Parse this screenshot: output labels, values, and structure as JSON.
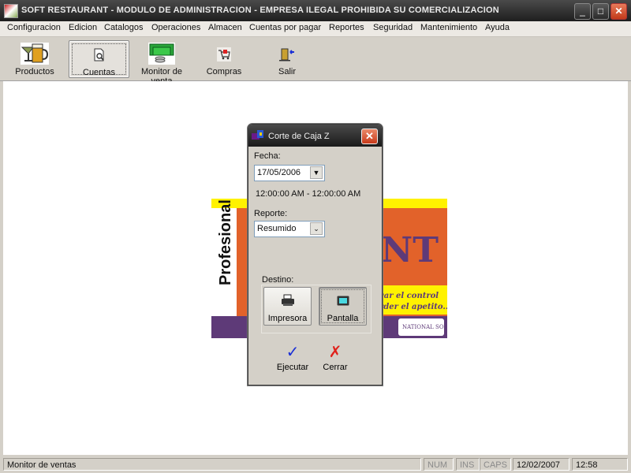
{
  "window": {
    "title": "SOFT RESTAURANT  -  MODULO DE ADMINISTRACION - EMPRESA ILEGAL PROHIBIDA SU COMERCIALIZACION",
    "controls": {
      "minimize": "_",
      "maximize": "□",
      "close": "✕"
    }
  },
  "menu": {
    "items": [
      "Configuracion",
      "Edicion",
      "Catalogos",
      "Operaciones",
      "Almacen",
      "Cuentas por pagar",
      "Reportes",
      "Seguridad",
      "Mantenimiento",
      "Ayuda"
    ]
  },
  "toolbar": {
    "items": [
      {
        "label": "Productos",
        "icon": "drinks-icon"
      },
      {
        "label": "Cuentas",
        "icon": "document-search-icon",
        "active": true
      },
      {
        "label": "Monitor de venta",
        "icon": "money-icon"
      },
      {
        "label": "Compras",
        "icon": "shopping-cart-icon"
      },
      {
        "label": "Salir",
        "icon": "exit-door-icon"
      }
    ]
  },
  "banner": {
    "side_text": "Profesional",
    "slogan_line1": "var el control",
    "slogan_line2": "rder el apetito...\"",
    "brand": "NATIONAL SOFT",
    "logo_text": "NT"
  },
  "dialog": {
    "title": "Corte de Caja Z",
    "fecha_label": "Fecha:",
    "fecha_value": "17/05/2006",
    "time_range": "12:00:00 AM - 12:00:00 AM",
    "reporte_label": "Reporte:",
    "reporte_value": "Resumido",
    "destino_label": "Destino:",
    "destino_options": [
      {
        "label": "Impresora",
        "icon": "printer-icon",
        "selected": false
      },
      {
        "label": "Pantalla",
        "icon": "monitor-icon",
        "selected": true
      }
    ],
    "ejecutar_label": "Ejecutar",
    "cerrar_label": "Cerrar",
    "close_glyph": "✕"
  },
  "statusbar": {
    "message": "Monitor de ventas",
    "num": "NUM",
    "ins": "INS",
    "caps": "CAPS",
    "date": "12/02/2007",
    "time": "12:58"
  },
  "colors": {
    "banner_orange": "#e2622a",
    "banner_yellow": "#fff200",
    "banner_purple": "#5e3a78",
    "check_blue": "#1a2fd6",
    "cross_red": "#e0201a"
  }
}
